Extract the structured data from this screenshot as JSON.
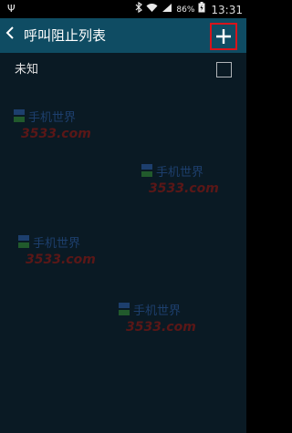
{
  "status_bar": {
    "usb_icon": "usb-icon",
    "bluetooth_icon": "bluetooth-icon",
    "wifi_icon": "wifi-icon",
    "signal_icon": "signal-icon",
    "battery_percent": "86%",
    "battery_icon": "battery-charging-icon",
    "time": "13:31"
  },
  "action_bar": {
    "back_icon": "back-chevron-icon",
    "title": "呼叫阻止列表",
    "add_icon": "plus-icon",
    "highlight_color": "#d8141b"
  },
  "list": {
    "items": [
      {
        "label": "未知",
        "checked": false
      }
    ]
  },
  "watermark": {
    "brand_text": "手机世界",
    "site_text": "3533.com"
  },
  "colors": {
    "action_bar_bg": "#0f4c63",
    "content_bg": "#0a1a24"
  }
}
